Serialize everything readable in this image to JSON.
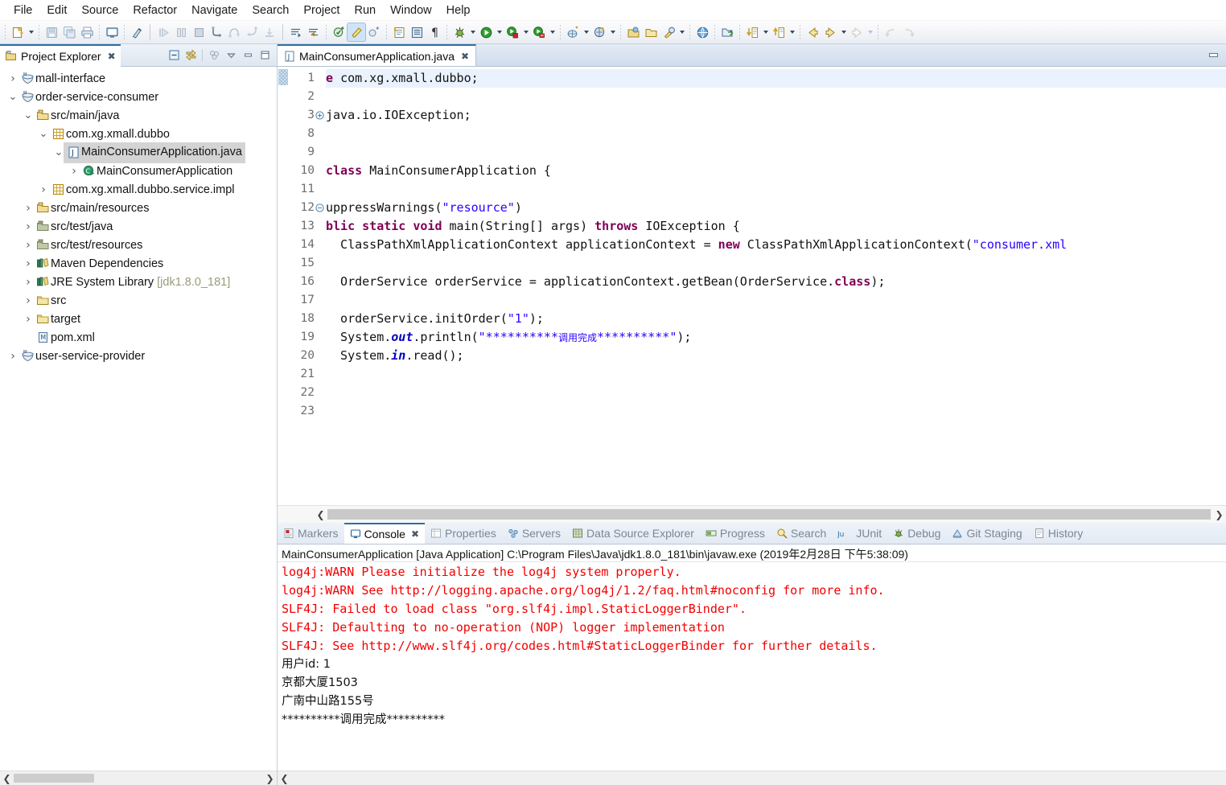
{
  "menu": {
    "items": [
      {
        "label": "File"
      },
      {
        "label": "Edit"
      },
      {
        "label": "Source"
      },
      {
        "label": "Refactor"
      },
      {
        "label": "Navigate"
      },
      {
        "label": "Search"
      },
      {
        "label": "Project"
      },
      {
        "label": "Run"
      },
      {
        "label": "Window"
      },
      {
        "label": "Help"
      }
    ]
  },
  "toolbar": {
    "icons": [
      "new-wizard-icon",
      "new-wizard-dropdown",
      "save-icon",
      "save-all-icon",
      "print-icon",
      "toggle-console-icon",
      "remove-all-annotations-icon",
      "resume-icon",
      "suspend-icon",
      "terminate-icon",
      "step-into-icon",
      "step-over-icon",
      "step-return-icon",
      "drop-to-frame-icon",
      "next-annotation-icon",
      "previous-annotation-icon",
      "new-java-project-icon",
      "new-java-package-icon",
      "new-class-icon",
      "open-task-icon",
      "open-type-icon",
      "show-whitespace-icon",
      "debug-icon",
      "debug-dropdown",
      "run-icon",
      "run-dropdown",
      "run-as-server-icon",
      "run-as-server-dropdown",
      "coverage-icon",
      "coverage-dropdown",
      "new-server-icon",
      "new-server-dropdown",
      "search-icon",
      "search-dropdown",
      "open-perspective-icon",
      "open-folder-icon",
      "external-tools-icon",
      "external-tools-dropdown",
      "web-browser-icon",
      "import-icon",
      "last-edit-location-icon",
      "last-edit-dropdown",
      "back-icon",
      "back-dropdown",
      "forward-icon",
      "forward-dropdown",
      "previous-edit-icon",
      "next-edit-icon"
    ]
  },
  "project_explorer": {
    "tab_label": "Project Explorer",
    "tools": [
      "collapse-all-icon",
      "link-with-editor-icon",
      "filters-icon",
      "view-menu-icon",
      "minimize-icon",
      "maximize-icon"
    ],
    "tree": [
      {
        "label": "mall-interface",
        "indent": 0,
        "twisty": "collapsed",
        "icon": "maven-project-icon",
        "selected": false
      },
      {
        "label": "order-service-consumer",
        "indent": 0,
        "twisty": "expanded",
        "icon": "maven-project-icon",
        "selected": false
      },
      {
        "label": "src/main/java",
        "indent": 1,
        "twisty": "expanded",
        "icon": "source-folder-icon",
        "selected": false
      },
      {
        "label": "com.xg.xmall.dubbo",
        "indent": 2,
        "twisty": "expanded",
        "icon": "package-icon",
        "selected": false
      },
      {
        "label": "MainConsumerApplication.java",
        "indent": 3,
        "twisty": "expanded",
        "icon": "java-file-icon",
        "selected": true
      },
      {
        "label": "MainConsumerApplication",
        "indent": 4,
        "twisty": "collapsed",
        "icon": "java-class-runnable-icon",
        "selected": false
      },
      {
        "label": "com.xg.xmall.dubbo.service.impl",
        "indent": 2,
        "twisty": "collapsed",
        "icon": "package-icon",
        "selected": false
      },
      {
        "label": "src/main/resources",
        "indent": 1,
        "twisty": "collapsed",
        "icon": "source-folder-icon",
        "selected": false
      },
      {
        "label": "src/test/java",
        "indent": 1,
        "twisty": "collapsed",
        "icon": "source-folder-gray-icon",
        "selected": false
      },
      {
        "label": "src/test/resources",
        "indent": 1,
        "twisty": "collapsed",
        "icon": "source-folder-gray-icon",
        "selected": false
      },
      {
        "label": "Maven Dependencies",
        "indent": 1,
        "twisty": "collapsed",
        "icon": "library-icon",
        "selected": false
      },
      {
        "label": "JRE System Library",
        "suffix": " [jdk1.8.0_181]",
        "indent": 1,
        "twisty": "collapsed",
        "icon": "library-icon",
        "selected": false
      },
      {
        "label": "src",
        "indent": 1,
        "twisty": "collapsed",
        "icon": "folder-icon",
        "selected": false
      },
      {
        "label": "target",
        "indent": 1,
        "twisty": "collapsed",
        "icon": "folder-icon",
        "selected": false
      },
      {
        "label": "pom.xml",
        "indent": 1,
        "twisty": "none",
        "icon": "maven-pom-icon",
        "selected": false
      },
      {
        "label": "user-service-provider",
        "indent": 0,
        "twisty": "collapsed",
        "icon": "maven-project-icon",
        "selected": false
      }
    ]
  },
  "editor": {
    "tab_label": "MainConsumerApplication.java",
    "tab_icon": "java-file-icon",
    "minimize_icon": "minimize-icon",
    "scroll_left_icon": "chevron-left-icon",
    "scroll_right_icon": "chevron-right-icon",
    "line_numbers": [
      "1",
      "2",
      "3",
      "8",
      "9",
      "10",
      "11",
      "12",
      "13",
      "14",
      "15",
      "16",
      "17",
      "18",
      "19",
      "20",
      "21",
      "22",
      "23"
    ],
    "fold_markers": {
      "3": "plus",
      "12": "minus"
    },
    "highlighted_line": 1,
    "lines": [
      {
        "n": "1",
        "segs": [
          {
            "t": "e ",
            "c": "kw2"
          },
          {
            "t": "com.xg.xmall.dubbo;",
            "c": "pl"
          }
        ]
      },
      {
        "n": "2",
        "segs": []
      },
      {
        "n": "3",
        "segs": [
          {
            "t": "java.io.IOException;",
            "c": "pl"
          }
        ]
      },
      {
        "n": "8",
        "segs": []
      },
      {
        "n": "9",
        "segs": []
      },
      {
        "n": "10",
        "segs": [
          {
            "t": "class ",
            "c": "kw2"
          },
          {
            "t": "MainConsumerApplication {",
            "c": "pl"
          }
        ]
      },
      {
        "n": "11",
        "segs": []
      },
      {
        "n": "12",
        "segs": [
          {
            "t": "uppressWarnings(",
            "c": "pl"
          },
          {
            "t": "\"resource\"",
            "c": "str"
          },
          {
            "t": ")",
            "c": "pl"
          }
        ]
      },
      {
        "n": "13",
        "segs": [
          {
            "t": "blic ",
            "c": "kw2"
          },
          {
            "t": "static ",
            "c": "kw2"
          },
          {
            "t": "void ",
            "c": "kw2"
          },
          {
            "t": "main(String[] args) ",
            "c": "pl"
          },
          {
            "t": "throws ",
            "c": "kw2"
          },
          {
            "t": "IOException {",
            "c": "pl"
          }
        ]
      },
      {
        "n": "14",
        "segs": [
          {
            "t": "  ClassPathXmlApplicationContext applicationContext = ",
            "c": "pl"
          },
          {
            "t": "new ",
            "c": "kw2"
          },
          {
            "t": "ClassPathXmlApplicationContext(",
            "c": "pl"
          },
          {
            "t": "\"consumer.xml",
            "c": "str"
          }
        ]
      },
      {
        "n": "15",
        "segs": []
      },
      {
        "n": "16",
        "segs": [
          {
            "t": "  OrderService orderService = applicationContext.getBean(OrderService.",
            "c": "pl"
          },
          {
            "t": "class",
            "c": "kw2"
          },
          {
            "t": ");",
            "c": "pl"
          }
        ]
      },
      {
        "n": "17",
        "segs": []
      },
      {
        "n": "18",
        "segs": [
          {
            "t": "  orderService.initOrder(",
            "c": "pl"
          },
          {
            "t": "\"1\"",
            "c": "str"
          },
          {
            "t": ");",
            "c": "pl"
          }
        ]
      },
      {
        "n": "19",
        "segs": [
          {
            "t": "  System.",
            "c": "pl"
          },
          {
            "t": "out",
            "c": "fld"
          },
          {
            "t": ".println(",
            "c": "pl"
          },
          {
            "t": "\"**********",
            "c": "str"
          },
          {
            "t": "调用完成",
            "c": "cjk"
          },
          {
            "t": "**********\"",
            "c": "str"
          },
          {
            "t": ");",
            "c": "pl"
          }
        ]
      },
      {
        "n": "20",
        "segs": [
          {
            "t": "  System.",
            "c": "pl"
          },
          {
            "t": "in",
            "c": "fld"
          },
          {
            "t": ".read();",
            "c": "pl"
          }
        ]
      },
      {
        "n": "21",
        "segs": []
      },
      {
        "n": "22",
        "segs": []
      },
      {
        "n": "23",
        "segs": []
      }
    ]
  },
  "bottom_panel": {
    "tabs": [
      {
        "label": "Markers",
        "icon": "markers-icon",
        "active": false
      },
      {
        "label": "Console",
        "icon": "console-icon",
        "active": true
      },
      {
        "label": "Properties",
        "icon": "properties-icon",
        "active": false
      },
      {
        "label": "Servers",
        "icon": "servers-icon",
        "active": false
      },
      {
        "label": "Data Source Explorer",
        "icon": "datasource-icon",
        "active": false
      },
      {
        "label": "Progress",
        "icon": "progress-icon",
        "active": false
      },
      {
        "label": "Search",
        "icon": "search-icon",
        "active": false
      },
      {
        "label": "JUnit",
        "icon": "junit-icon",
        "active": false
      },
      {
        "label": "Debug",
        "icon": "debug-icon",
        "active": false
      },
      {
        "label": "Git Staging",
        "icon": "git-staging-icon",
        "active": false
      },
      {
        "label": "History",
        "icon": "history-icon",
        "active": false
      }
    ],
    "console_header": "MainConsumerApplication [Java Application] C:\\Program Files\\Java\\jdk1.8.0_181\\bin\\javaw.exe (2019年2月28日 下午5:38:09)",
    "output": [
      {
        "text": "log4j:WARN Please initialize the log4j system properly.",
        "error": true
      },
      {
        "text": "log4j:WARN See http://logging.apache.org/log4j/1.2/faq.html#noconfig for more info.",
        "error": true
      },
      {
        "text": "SLF4J: Failed to load class \"org.slf4j.impl.StaticLoggerBinder\".",
        "error": true
      },
      {
        "text": "SLF4J: Defaulting to no-operation (NOP) logger implementation",
        "error": true
      },
      {
        "text": "SLF4J: See http://www.slf4j.org/codes.html#StaticLoggerBinder for further details.",
        "error": true
      },
      {
        "text": "用户id: 1",
        "error": false,
        "cjk": true
      },
      {
        "text": "京都大厦1503",
        "error": false,
        "cjk": true
      },
      {
        "text": "广南中山路155号",
        "error": false,
        "cjk": true
      },
      {
        "text": "**********调用完成**********",
        "error": false,
        "cjk": true
      }
    ]
  },
  "colors": {
    "accent": "#2f6ea5",
    "error_text": "#f20000",
    "keyword": "#a5145a",
    "string": "#2a00ff",
    "selection": "#d4d4d4",
    "line_highlight": "#eaf2fd"
  }
}
